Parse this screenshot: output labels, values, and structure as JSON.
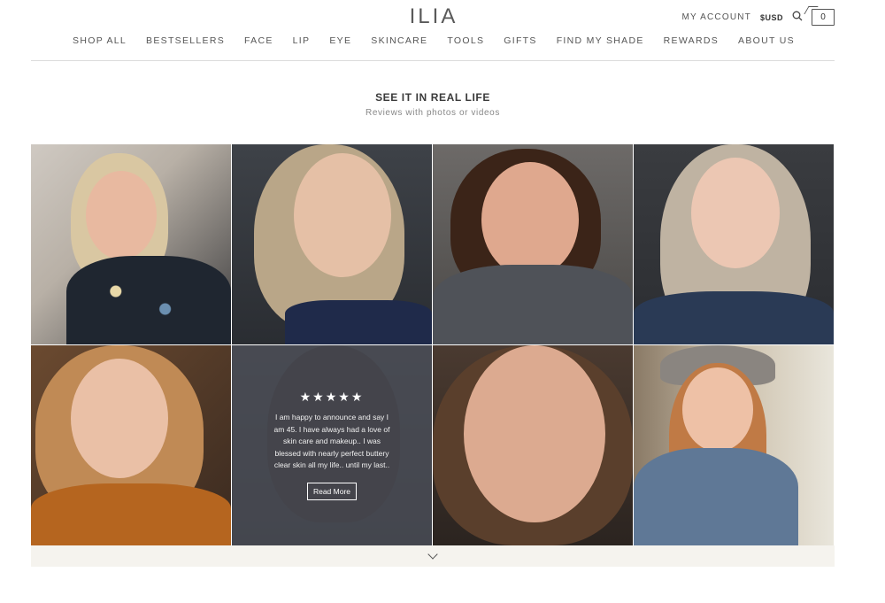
{
  "header": {
    "logo": "ILIA",
    "my_account": "MY ACCOUNT",
    "currency": "$USD",
    "bag_count": "0"
  },
  "nav": {
    "items": [
      {
        "label": "SHOP ALL"
      },
      {
        "label": "BESTSELLERS"
      },
      {
        "label": "FACE"
      },
      {
        "label": "LIP"
      },
      {
        "label": "EYE"
      },
      {
        "label": "SKINCARE"
      },
      {
        "label": "TOOLS"
      },
      {
        "label": "GIFTS"
      },
      {
        "label": "FIND MY SHADE"
      },
      {
        "label": "REWARDS"
      },
      {
        "label": "ABOUT US"
      }
    ]
  },
  "section": {
    "title": "SEE IT IN REAL LIFE",
    "subtitle": "Reviews with photos or videos"
  },
  "review_overlay": {
    "stars": "★★★★★",
    "text": "I am happy to announce and say I am 45. I have always had a love of skin care and makeup.. I was blessed with nearly perfect buttery clear skin all my life.. until my last..",
    "button": "Read More"
  },
  "colors": {
    "accent": "#3a3a3a",
    "loadbar": "#f5f3ee"
  },
  "icons": [
    "search-icon",
    "bag-icon",
    "chevron-down-icon",
    "star-icon"
  ]
}
